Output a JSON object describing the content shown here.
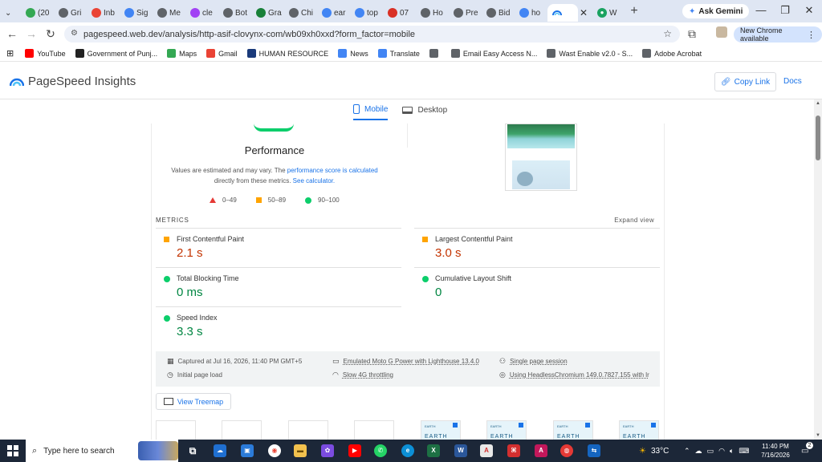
{
  "browser": {
    "tabs": [
      {
        "label": "(20",
        "color": "#34a853"
      },
      {
        "label": "Gri",
        "color": "#5f6368"
      },
      {
        "label": "Inb",
        "color": "#ea4335"
      },
      {
        "label": "Sig",
        "color": "#4285f4"
      },
      {
        "label": "Me",
        "color": "#5f6368"
      },
      {
        "label": "cle",
        "color": "#a142f4"
      },
      {
        "label": "Bot",
        "color": "#5f6368"
      },
      {
        "label": "Gra",
        "color": "#188038"
      },
      {
        "label": "Chi",
        "color": "#5f6368"
      },
      {
        "label": "ear",
        "color": "#4285f4"
      },
      {
        "label": "top",
        "color": "#4285f4"
      },
      {
        "label": "07",
        "color": "#d93025"
      },
      {
        "label": "Ho",
        "color": "#5f6368"
      },
      {
        "label": "Pre",
        "color": "#5f6368"
      },
      {
        "label": "Bid",
        "color": "#5f6368"
      },
      {
        "label": "ho",
        "color": "#4285f4"
      }
    ],
    "active_tab_label": "",
    "after_active_tab": {
      "label": "W",
      "color": "#1aa260"
    },
    "ask_gemini": "Ask Gemini",
    "url": "pagespeed.web.dev/analysis/http-asif-clovynx-com/wb09xh0xxd?form_factor=mobile",
    "new_chrome": "New Chrome available",
    "bookmarks": [
      {
        "label": "YouTube",
        "color": "#ff0000"
      },
      {
        "label": "Government of Punj...",
        "color": "#222222"
      },
      {
        "label": "Maps",
        "color": "#34a853"
      },
      {
        "label": "Gmail",
        "color": "#ea4335"
      },
      {
        "label": "HUMAN RESOURCE",
        "color": "#1a3a7a"
      },
      {
        "label": "News",
        "color": "#4285f4"
      },
      {
        "label": "Translate",
        "color": "#4285f4"
      },
      {
        "label": "",
        "color": "#5f6368"
      },
      {
        "label": "Email Easy Access N...",
        "color": "#5f6368"
      },
      {
        "label": "Wast Enable v2.0 - S...",
        "color": "#5f6368"
      },
      {
        "label": "Adobe Acrobat",
        "color": "#5f6368"
      }
    ]
  },
  "psi": {
    "title": "PageSpeed Insights",
    "copy_link": "Copy Link",
    "docs": "Docs",
    "device_tabs": {
      "mobile": "Mobile",
      "desktop": "Desktop"
    },
    "performance_title": "Performance",
    "note_prefix": "Values are estimated and may vary. The",
    "note_link1": "performance score is calculated",
    "note_middle": "directly from these metrics.",
    "note_link2": "See calculator.",
    "legend": {
      "poor": "0–49",
      "average": "50–89",
      "good": "90–100"
    },
    "metrics_label": "METRICS",
    "expand_view": "Expand view",
    "metrics": [
      {
        "label": "First Contentful Paint",
        "value": "2.1 s",
        "rating": "average"
      },
      {
        "label": "Largest Contentful Paint",
        "value": "3.0 s",
        "rating": "average"
      },
      {
        "label": "Total Blocking Time",
        "value": "0 ms",
        "rating": "good"
      },
      {
        "label": "Cumulative Layout Shift",
        "value": "0",
        "rating": "good"
      },
      {
        "label": "Speed Index",
        "value": "3.3 s",
        "rating": "good"
      }
    ],
    "info": {
      "captured": "Captured at Jul 16, 2026, 11:40 PM GMT+5",
      "emulated": "Emulated Moto G Power with Lighthouse 13.4.0",
      "session": "Single page session",
      "initial": "Initial page load",
      "throttling": "Slow 4G throttling",
      "browser": "Using HeadlessChromium 149.0.7827.155 with lr"
    },
    "treemap": "View Treemap",
    "thumb_top": "EARTH",
    "thumb_label": "EARTH"
  },
  "taskbar": {
    "search": "Type here to search",
    "temperature": "33°C",
    "time": "11:40 PM",
    "date": "7/16/2026",
    "notifications": "2",
    "weather_badge": "2"
  }
}
